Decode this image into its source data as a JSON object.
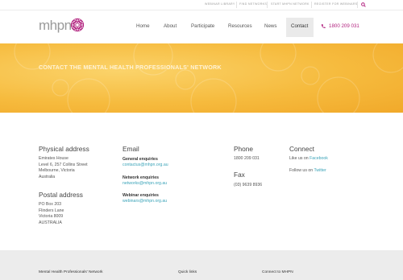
{
  "utility_bar": {
    "links": [
      "WEBINAR LIBRARY",
      "FIND NETWORKS",
      "START MHPN NETWORK",
      "REGISTER FOR WEBINARS"
    ]
  },
  "header": {
    "logo_text": "mhpn",
    "nav": [
      "Home",
      "About",
      "Participate",
      "Resources",
      "News",
      "Contact"
    ],
    "active_nav": "Contact",
    "phone": "1800 209 031",
    "accent_color": "#b2227f"
  },
  "banner": {
    "title": "CONTACT THE MENTAL HEALTH PROFESSIONALS' NETWORK",
    "color": "#f6bb3e"
  },
  "physical_address": {
    "heading": "Physical address",
    "lines": [
      "Emirates House",
      "Level 6, 257 Collins Street",
      "Melbourne, Victoria",
      "Australia"
    ]
  },
  "postal_address": {
    "heading": "Postal address",
    "lines": [
      "PO Box 203",
      "Flinders Lane",
      "Victoria 8009",
      "AUSTRALIA"
    ]
  },
  "email": {
    "heading": "Email",
    "groups": [
      {
        "label": "General enquiries",
        "address": "contactus@mhpn.org.au"
      },
      {
        "label": "Network enquiries",
        "address": "networks@mhpn.org.au"
      },
      {
        "label": "Webinar enquiries",
        "address": "webinars@mhpn.org.au"
      }
    ]
  },
  "phone_block": {
    "heading": "Phone",
    "value": "1800 209 031"
  },
  "fax_block": {
    "heading": "Fax",
    "value": "(03) 9639 8936"
  },
  "connect": {
    "heading": "Connect",
    "facebook_prefix": "Like us on ",
    "facebook_link": "Facebook",
    "twitter_prefix": "Follow us on ",
    "twitter_link": "Twitter"
  },
  "footer": {
    "col1": "Mental Health Professionals' Network",
    "col2": "Quick links",
    "col3": "Connect to MHPN"
  }
}
